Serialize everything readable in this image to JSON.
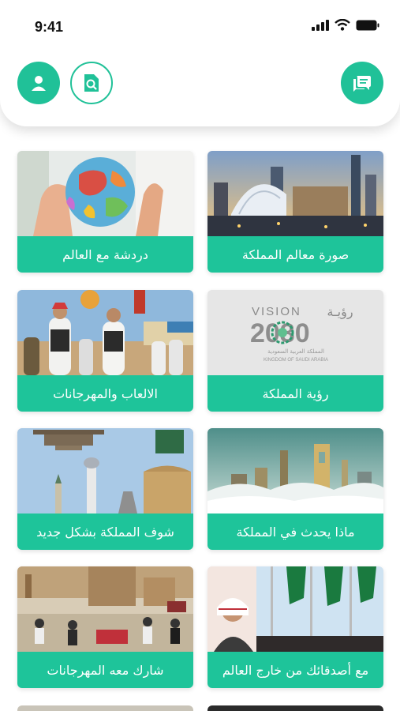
{
  "status_bar": {
    "time": "9:41"
  },
  "header": {
    "profile_icon": "person-icon",
    "search_icon": "search-document-icon",
    "chat_icon": "chat-bubble-icon"
  },
  "cards": [
    {
      "label": "دردشة مع العالم",
      "image": "hands-holding-globe"
    },
    {
      "label": "صورة معالم المملكة",
      "image": "riyadh-skyline"
    },
    {
      "label": "الالعاب والمهرجانات",
      "image": "traditional-dance"
    },
    {
      "label": "رؤية المملكة",
      "image": "vision-2030-logo"
    },
    {
      "label": "شوف المملكة بشكل جديد",
      "image": "landmarks-collage"
    },
    {
      "label": "ماذا يحدث في المملكة",
      "image": "city-above-clouds"
    },
    {
      "label": "شارك معه المهرجانات",
      "image": "festival-crowd"
    },
    {
      "label": "مع أصدقائك من خارج العالم",
      "image": "king-portrait-flags"
    }
  ],
  "vision_logo": {
    "vision": "VISION",
    "roya": "رؤيـة",
    "year": "2030",
    "ar_sub": "المملكة العربية السعودية",
    "en_sub": "KINGDOM OF SAUDI ARABIA"
  },
  "colors": {
    "accent": "#1ec49a",
    "background": "#ffffff"
  }
}
